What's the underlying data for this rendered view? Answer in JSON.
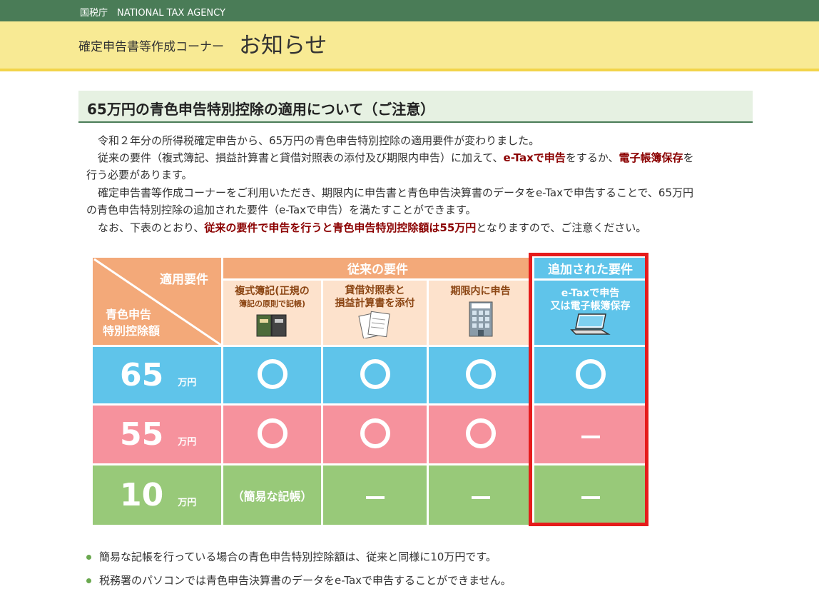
{
  "header": {
    "agency": "国税庁　NATIONAL TAX AGENCY",
    "subtitle": "確定申告書等作成コーナー",
    "title": "お知らせ"
  },
  "article": {
    "heading": "65万円の青色申告特別控除の適用について（ご注意）",
    "p1": "令和２年分の所得税確定申告から、65万円の青色申告特別控除の適用要件が変わりました。",
    "p2a": "従来の要件（複式簿記、損益計算書と貸借対照表の添付及び期限内申告）に加えて、",
    "p2b": "e-Taxで申告",
    "p2c": "をするか、",
    "p2d": "電子帳簿保存",
    "p2e": "を",
    "p3": "行う必要があります。",
    "p4": "確定申告書等作成コーナーをご利用いただき、期限内に申告書と青色申告決算書のデータをe-Taxで申告することで、65万円",
    "p5": "の青色申告特別控除の追加された要件（e-Taxで申告）を満たすことができます。",
    "p6a": "なお、下表のとおり、",
    "p6b": "従来の要件で申告を行うと青色申告特別控除額は55万円",
    "p6c": "となりますので、ご注意ください。"
  },
  "table": {
    "corner_top": "適用要件",
    "corner_bottom_1": "青色申告",
    "corner_bottom_2": "特別控除額",
    "group_old": "従来の要件",
    "group_new": "追加された要件",
    "col1_line1": "複式簿記(正規の",
    "col1_line2": "簿記の原則で記帳)",
    "col2_line1": "貸借対照表と",
    "col2_line2": "損益計算書を添付",
    "col3": "期限内に申告",
    "col3_sign": "税務署",
    "col4_line1": "e-Taxで申告",
    "col4_line2": "又は電子帳簿保存",
    "unit": "万円",
    "rows": [
      {
        "amount": "65",
        "cells": [
          "circle",
          "circle",
          "circle",
          "circle"
        ]
      },
      {
        "amount": "55",
        "cells": [
          "circle",
          "circle",
          "circle",
          "dash"
        ]
      },
      {
        "amount": "10",
        "cells": [
          "text",
          "dash",
          "dash",
          "dash"
        ]
      }
    ],
    "kanni_label": "（簡易な記帳）"
  },
  "notes": [
    "簡易な記帳を行っている場合の青色申告特別控除額は、従来と同様に10万円です。",
    "税務署のパソコンでは青色申告決算書のデータをe-Taxで申告することができません。"
  ],
  "colors": {
    "header_green": "#4a7c57",
    "banner_yellow": "#f8ea94",
    "row_65": "#5fc4ea",
    "row_55": "#f6929d",
    "row_10": "#98c979",
    "header_orange": "#f3a979",
    "highlight_red": "#e51b1b",
    "emphasis": "#8b0000"
  }
}
